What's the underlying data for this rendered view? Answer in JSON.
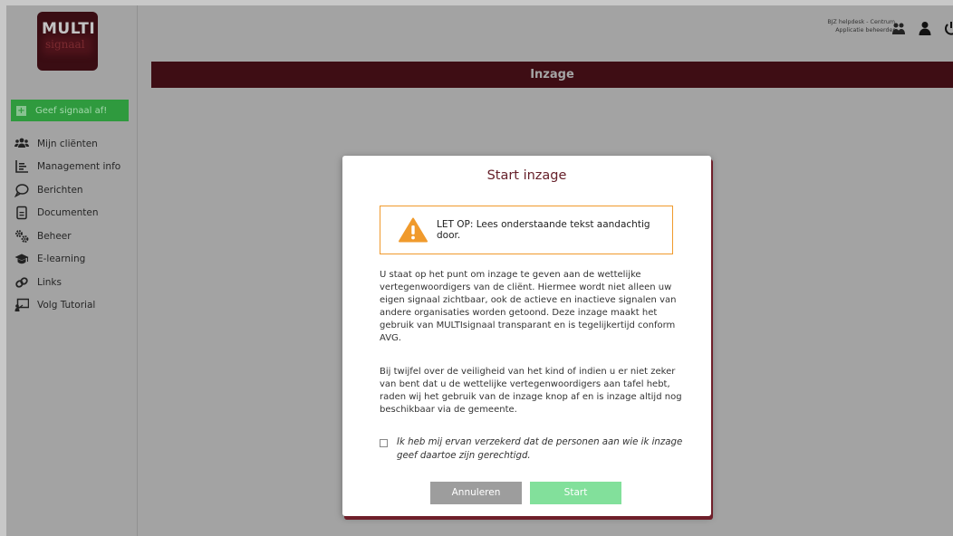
{
  "logo": {
    "line1": "MULTI",
    "line2": "signaal"
  },
  "sidebar": {
    "cta_label": "Geef signaal af!",
    "items": [
      {
        "label": "Mijn cliënten",
        "icon": "users-icon"
      },
      {
        "label": "Management info",
        "icon": "list-chart-icon"
      },
      {
        "label": "Berichten",
        "icon": "speech-bubble-icon"
      },
      {
        "label": "Documenten",
        "icon": "document-icon"
      },
      {
        "label": "Beheer",
        "icon": "gears-icon"
      },
      {
        "label": "E-learning",
        "icon": "graduation-cap-icon"
      },
      {
        "label": "Links",
        "icon": "link-icon"
      },
      {
        "label": "Volg Tutorial",
        "icon": "presentation-icon"
      }
    ]
  },
  "header": {
    "user_line1": "BJZ helpdesk - Centrum",
    "user_line2": "Applicatie beheerder",
    "banner_title": "Inzage"
  },
  "modal": {
    "title": "Start inzage",
    "warning": "LET OP: Lees onderstaande tekst aandachtig door.",
    "paragraph1": "U staat op het punt om inzage te geven aan de wettelijke vertegenwoordigers van de cliënt. Hiermee wordt niet alleen uw eigen signaal zichtbaar, ook de actieve en inactieve signalen van andere organisaties worden getoond. Deze inzage maakt het gebruik van MULTIsignaal transparant en is tegelijkertijd conform AVG.",
    "paragraph2": "Bij twijfel over de veiligheid van het kind of indien u er niet zeker van bent dat u de wettelijke vertegenwoordigers aan tafel hebt, raden wij het gebruik van de inzage knop af en is inzage altijd nog beschikbaar via de gemeente.",
    "checkbox_label": "Ik heb mij ervan verzekerd dat de personen aan wie ik inzage geef daartoe zijn gerechtigd.",
    "cancel_label": "Annuleren",
    "start_label": "Start"
  },
  "colors": {
    "brand": "#3e0d14",
    "cta_green": "#2f9a3e",
    "warning_orange": "#f09a2c",
    "start_green": "#82e09b",
    "cancel_grey": "#9d9d9d"
  }
}
